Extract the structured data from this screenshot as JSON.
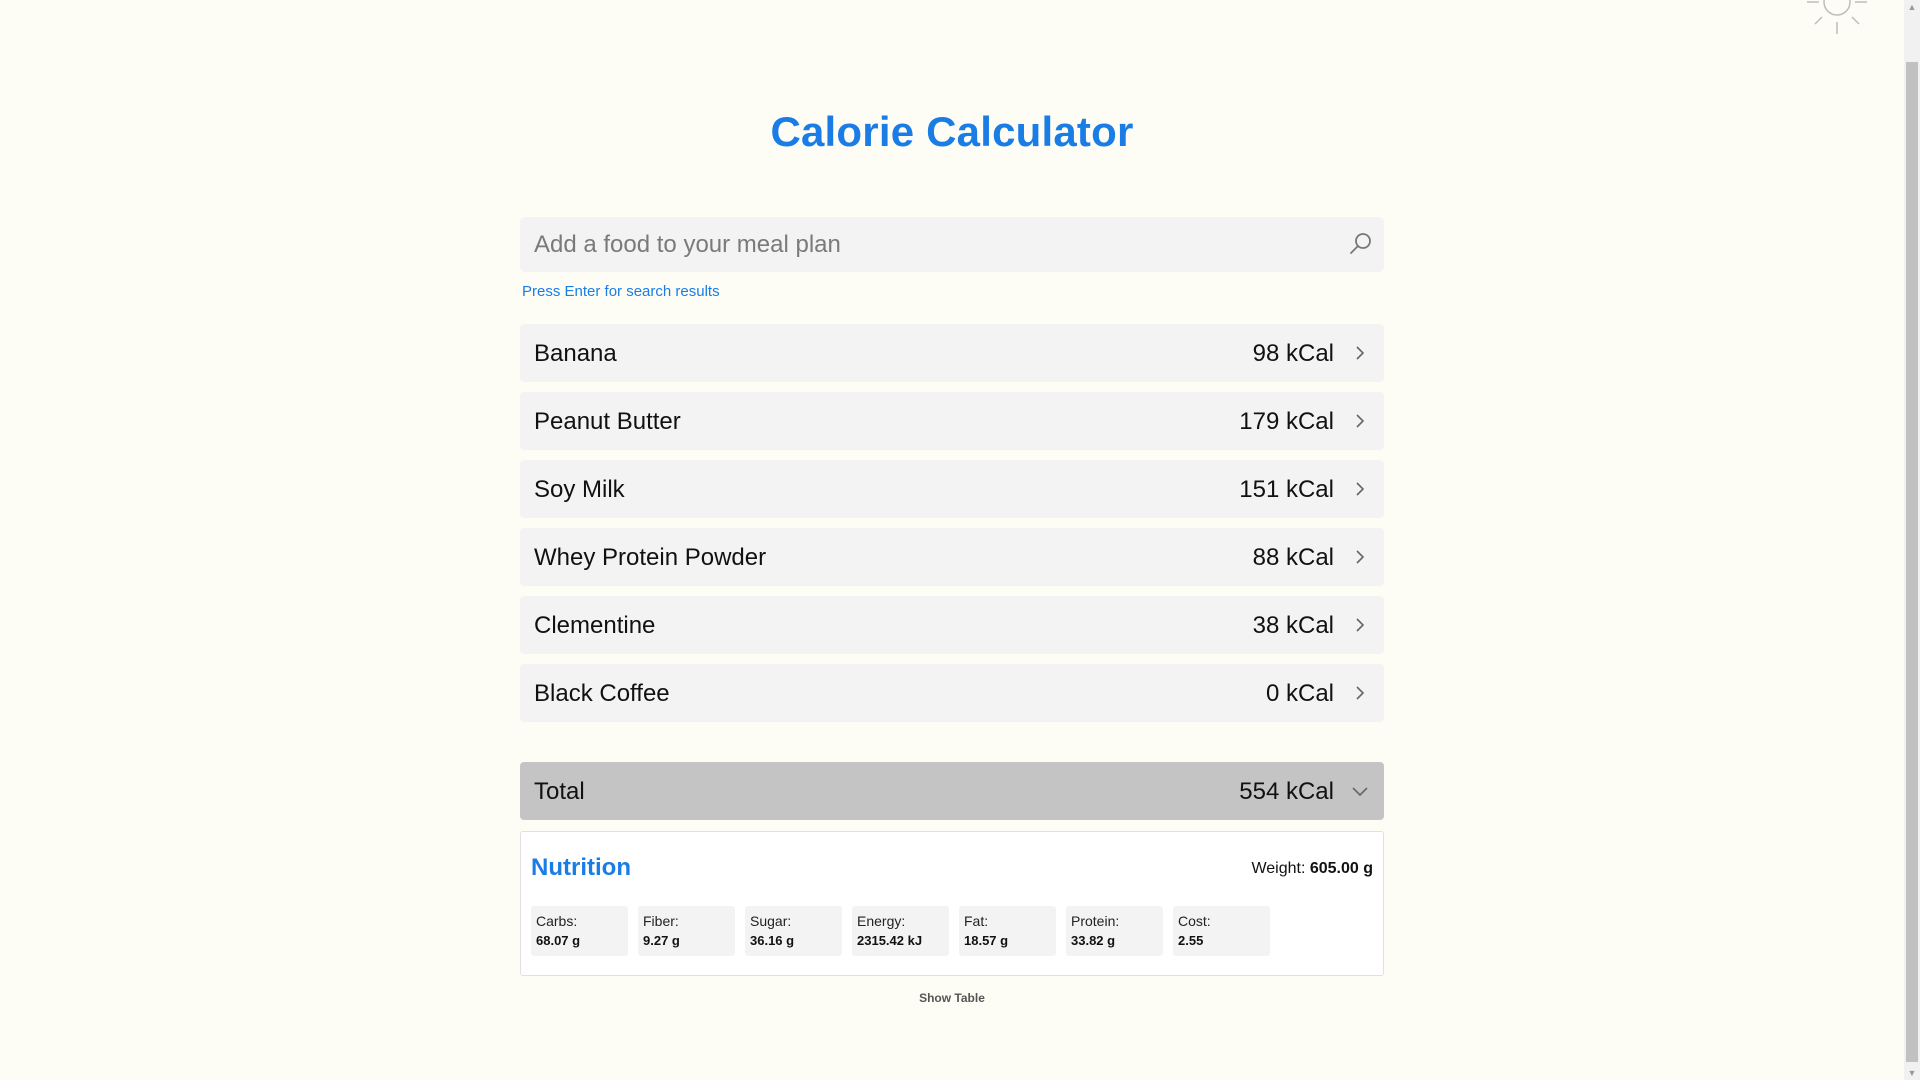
{
  "header": {
    "title": "Calorie Calculator"
  },
  "search": {
    "placeholder": "Add a food to your meal plan",
    "value": "",
    "hint": "Press Enter for search results"
  },
  "foods": [
    {
      "name": "Banana",
      "kcal": "98 kCal"
    },
    {
      "name": "Peanut Butter",
      "kcal": "179 kCal"
    },
    {
      "name": "Soy Milk",
      "kcal": "151 kCal"
    },
    {
      "name": "Whey Protein Powder",
      "kcal": "88 kCal"
    },
    {
      "name": "Clementine",
      "kcal": "38 kCal"
    },
    {
      "name": "Black Coffee",
      "kcal": "0 kCal"
    }
  ],
  "total": {
    "label": "Total",
    "kcal": "554 kCal"
  },
  "nutrition": {
    "title": "Nutrition",
    "weight_label": "Weight:",
    "weight_value": "605.00 g",
    "stats": [
      {
        "label": "Carbs:",
        "value": "68.07 g"
      },
      {
        "label": "Fiber:",
        "value": "9.27 g"
      },
      {
        "label": "Sugar:",
        "value": "36.16 g"
      },
      {
        "label": "Energy:",
        "value": "2315.42 kJ"
      },
      {
        "label": "Fat:",
        "value": "18.57 g"
      },
      {
        "label": "Protein:",
        "value": "33.82 g"
      },
      {
        "label": "Cost:",
        "value": "2.55"
      }
    ]
  },
  "show_table_label": "Show Table",
  "icons": {
    "theme_toggle": "sun-icon",
    "search": "search-icon",
    "row_chevron": "chevron-right-icon",
    "total_chevron": "chevron-down-icon"
  },
  "colors": {
    "accent": "#1a7de6",
    "background": "#fdfdf6",
    "row_bg": "#f3f3f3",
    "total_bg": "#c4c4c4"
  }
}
